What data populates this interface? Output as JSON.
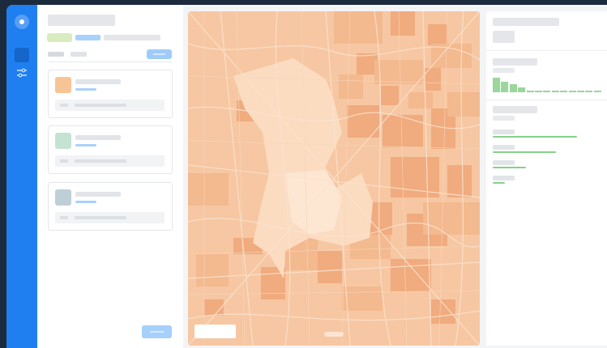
{
  "colors": {
    "rail": "#1f7ff1",
    "map_base": "#f6c7a2",
    "map_light": "#fbdcc1",
    "map_dark": "#f0a97a",
    "accent_blue": "#a9d1fb",
    "accent_green": "#86d18a"
  },
  "nav": {
    "icons": [
      "logo-icon",
      "home-icon",
      "filters-icon"
    ]
  },
  "layer_cards": [
    {
      "swatch_color": "#f7c595"
    },
    {
      "swatch_color": "#c4e3d2"
    },
    {
      "swatch_color": "#bfcfd8"
    }
  ],
  "histogram": {
    "values": [
      100,
      72,
      56,
      35,
      12,
      12,
      12,
      12,
      12,
      12,
      12,
      12,
      12
    ]
  },
  "stats": [
    {
      "fraction": 0.78
    },
    {
      "fraction": 0.59
    },
    {
      "fraction": 0.31
    },
    {
      "fraction": 0.11
    }
  ]
}
